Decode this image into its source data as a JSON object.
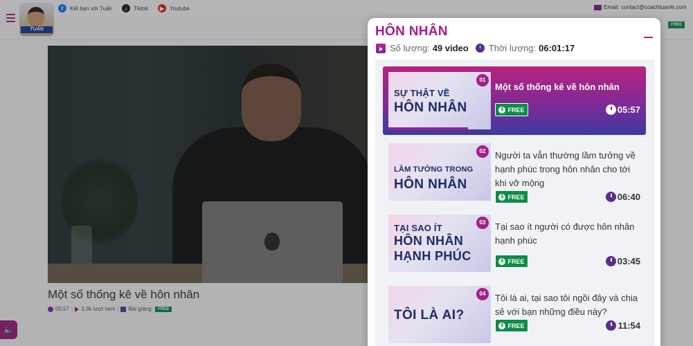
{
  "topbar": {
    "facebook_label": "Kết bạn với Tuấn",
    "tiktok_label": "Tiktok",
    "youtube_label": "Youtube",
    "email_label": "Email:",
    "email_value": "contact@coachtuanle.com"
  },
  "header": {
    "logo_text": "TUẤN",
    "free_label": "FREE"
  },
  "video": {
    "title": "Một số thống kê về hôn nhân",
    "duration": "05:57",
    "views": "3.3k lượt xem",
    "lessons_label": "Bài giảng:",
    "free_label": "FREE"
  },
  "playlist": {
    "title": "HÔN NHÂN",
    "count_label": "Số lượng:",
    "count_value": "49 video",
    "duration_label": "Thời lượng:",
    "duration_value": "06:01:17",
    "active_progress": 0.78,
    "items": [
      {
        "num": "01",
        "thumb_line1": "SỰ THẬT VỀ",
        "thumb_line2": "HÔN NHÂN",
        "thumb_line3": "",
        "title": "Một số thống kê về hôn nhân",
        "free": "FREE",
        "duration": "05:57"
      },
      {
        "num": "02",
        "thumb_line1": "LẦM TƯỞNG TRONG",
        "thumb_line2": "HÔN NHÂN",
        "thumb_line3": "",
        "title": "Người ta vẫn thường lầm tưởng về hạnh phúc trong hôn nhân cho tới khi vỡ mộng",
        "free": "FREE",
        "duration": "06:40"
      },
      {
        "num": "03",
        "thumb_line1": "TẠI SAO ÍT",
        "thumb_line2": "HÔN NHÂN",
        "thumb_line3": "HẠNH PHÚC",
        "title": "Tại sao ít người có được hôn nhân hạnh phúc",
        "free": "FREE",
        "duration": "03:45"
      },
      {
        "num": "04",
        "thumb_line1": "",
        "thumb_line2": "TÔI LÀ AI?",
        "thumb_line3": "",
        "title": "Tôi là ai, tại sao tôi ngồi đây và chia sẻ với bạn những điều này?",
        "free": "FREE",
        "duration": "11:54"
      }
    ]
  }
}
